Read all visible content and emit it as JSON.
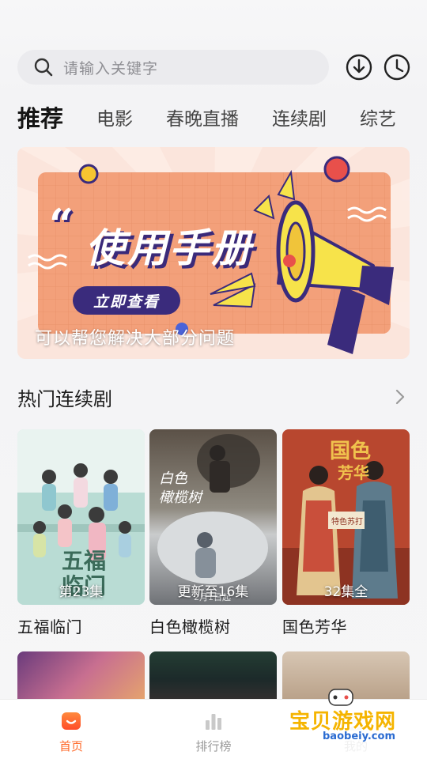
{
  "search": {
    "placeholder": "请输入关键字"
  },
  "tabs": [
    {
      "label": "推荐",
      "active": true
    },
    {
      "label": "电影",
      "active": false
    },
    {
      "label": "春晚直播",
      "active": false
    },
    {
      "label": "连续剧",
      "active": false
    },
    {
      "label": "综艺",
      "active": false
    }
  ],
  "banner": {
    "quote_mark": "“",
    "title": "使用手册",
    "cta_label": "立即查看",
    "caption": "可以帮您解决大部分问题"
  },
  "section": {
    "title": "热门连续剧"
  },
  "cards": [
    {
      "title": "五福临门",
      "badge": "第23集",
      "poster_text": "五福临门"
    },
    {
      "title": "白色橄榄树",
      "badge": "更新至16集",
      "poster_text": "白色橄榄树"
    },
    {
      "title": "国色芳华",
      "badge": "32集全",
      "poster_text": "国色芳华"
    }
  ],
  "bottom_nav": [
    {
      "label": "首页",
      "icon": "home-icon",
      "active": true
    },
    {
      "label": "排行榜",
      "icon": "chart-icon",
      "active": false
    },
    {
      "label": "我的",
      "icon": "profile-icon",
      "active": false
    }
  ],
  "watermark": {
    "text": "宝贝游戏网",
    "url": "baobeiy.com"
  },
  "colors": {
    "accent": "#ff6a2a",
    "banner_purple": "#3a2b7c",
    "banner_orange": "#f3a07a"
  }
}
